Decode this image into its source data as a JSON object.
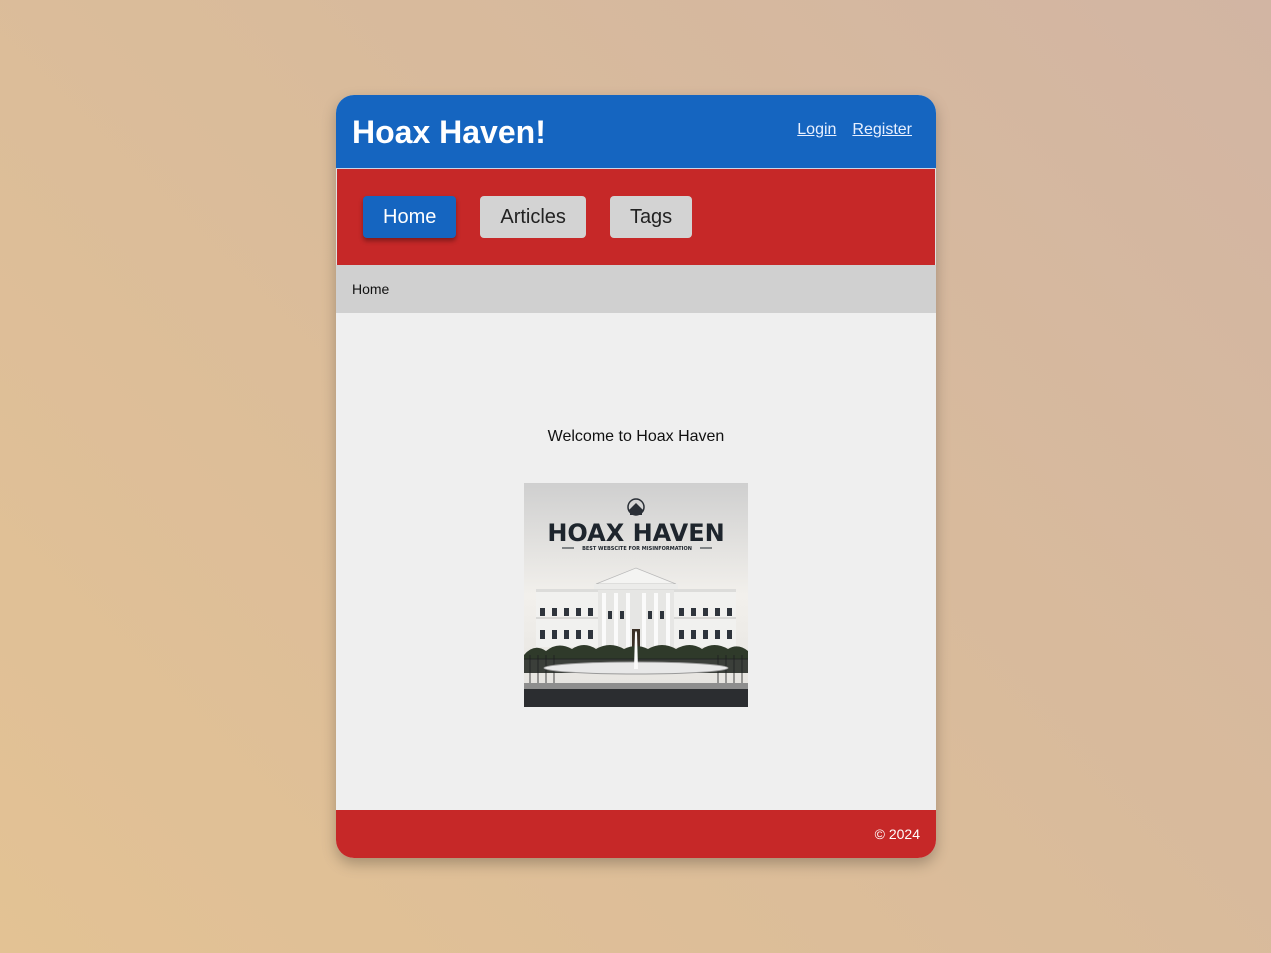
{
  "header": {
    "title": "Hoax Haven!",
    "login_label": "Login",
    "register_label": "Register"
  },
  "nav": {
    "items": [
      {
        "label": "Home",
        "active": true
      },
      {
        "label": "Articles",
        "active": false
      },
      {
        "label": "Tags",
        "active": false
      }
    ]
  },
  "breadcrumb": {
    "current": "Home"
  },
  "main": {
    "welcome_text": "Welcome to Hoax Haven",
    "hero_image": {
      "logo_text": "HOAX HAVEN",
      "tagline": "BEST WEBSCITE FOR MISINFORMATION"
    }
  },
  "footer": {
    "copyright": "© 2024"
  },
  "colors": {
    "primary_blue": "#1565c0",
    "primary_red": "#c62828",
    "breadcrumb_gray": "#d0d0d0",
    "content_bg": "#efefef"
  }
}
